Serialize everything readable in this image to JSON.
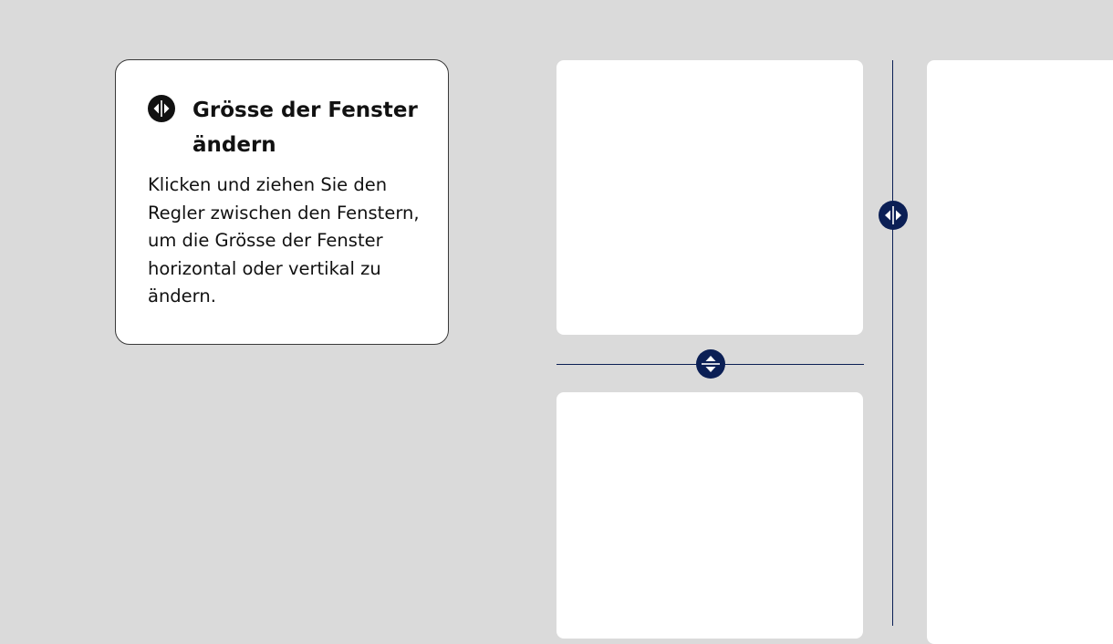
{
  "info_card": {
    "title": "Grösse der Fenster ändern",
    "body": "Klicken und ziehen Sie den Regler zwischen den Fenstern, um die Grösse der Fenster horizontal oder vertikal zu ändern.",
    "icon": "resize-horizontal-icon"
  },
  "panes": [
    {
      "name": "pane-top-left"
    },
    {
      "name": "pane-bottom-left"
    },
    {
      "name": "pane-right"
    }
  ],
  "splitters": {
    "horizontal_handle_icon": "resize-vertical-arrows-icon",
    "vertical_handle_icon": "resize-horizontal-arrows-icon"
  },
  "colors": {
    "background": "#dadada",
    "pane": "#ffffff",
    "accent": "#0b1f55",
    "text": "#111111"
  }
}
